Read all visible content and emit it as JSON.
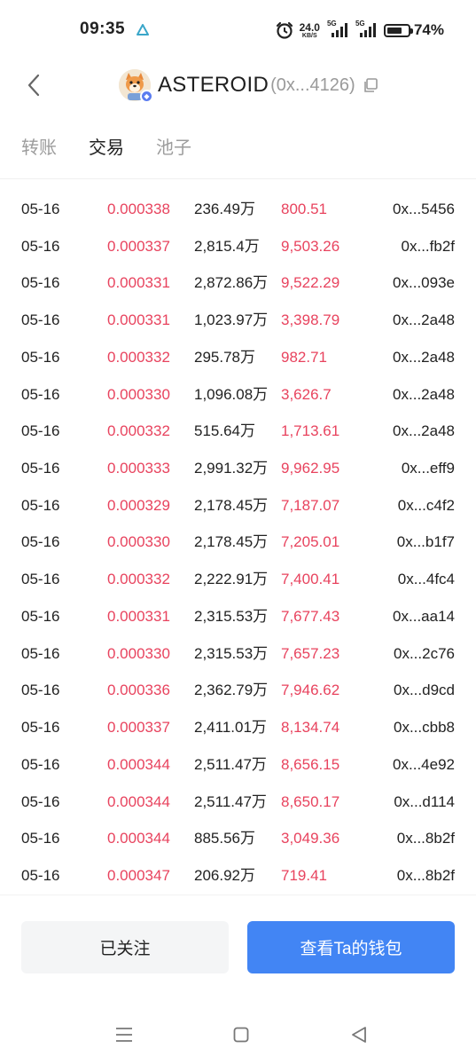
{
  "status_bar": {
    "time": "09:35",
    "net_speed": "24.0",
    "net_unit": "KB/S",
    "sim1_tag": "5G",
    "sim2_tag": "5G",
    "battery_pct": "74%",
    "battery_level": 0.74
  },
  "header": {
    "token_name": "ASTEROID",
    "token_address": "(0x...4126)"
  },
  "tabs": [
    {
      "label": "转账",
      "active": false
    },
    {
      "label": "交易",
      "active": true
    },
    {
      "label": "池子",
      "active": false
    }
  ],
  "trades": [
    {
      "date": "05-16",
      "price": "0.000338",
      "amount": "236.49万",
      "value": "800.51",
      "address": "0x...5456"
    },
    {
      "date": "05-16",
      "price": "0.000337",
      "amount": "2,815.4万",
      "value": "9,503.26",
      "address": "0x...fb2f"
    },
    {
      "date": "05-16",
      "price": "0.000331",
      "amount": "2,872.86万",
      "value": "9,522.29",
      "address": "0x...093e"
    },
    {
      "date": "05-16",
      "price": "0.000331",
      "amount": "1,023.97万",
      "value": "3,398.79",
      "address": "0x...2a48"
    },
    {
      "date": "05-16",
      "price": "0.000332",
      "amount": "295.78万",
      "value": "982.71",
      "address": "0x...2a48"
    },
    {
      "date": "05-16",
      "price": "0.000330",
      "amount": "1,096.08万",
      "value": "3,626.7",
      "address": "0x...2a48"
    },
    {
      "date": "05-16",
      "price": "0.000332",
      "amount": "515.64万",
      "value": "1,713.61",
      "address": "0x...2a48"
    },
    {
      "date": "05-16",
      "price": "0.000333",
      "amount": "2,991.32万",
      "value": "9,962.95",
      "address": "0x...eff9"
    },
    {
      "date": "05-16",
      "price": "0.000329",
      "amount": "2,178.45万",
      "value": "7,187.07",
      "address": "0x...c4f2"
    },
    {
      "date": "05-16",
      "price": "0.000330",
      "amount": "2,178.45万",
      "value": "7,205.01",
      "address": "0x...b1f7"
    },
    {
      "date": "05-16",
      "price": "0.000332",
      "amount": "2,222.91万",
      "value": "7,400.41",
      "address": "0x...4fc4"
    },
    {
      "date": "05-16",
      "price": "0.000331",
      "amount": "2,315.53万",
      "value": "7,677.43",
      "address": "0x...aa14"
    },
    {
      "date": "05-16",
      "price": "0.000330",
      "amount": "2,315.53万",
      "value": "7,657.23",
      "address": "0x...2c76"
    },
    {
      "date": "05-16",
      "price": "0.000336",
      "amount": "2,362.79万",
      "value": "7,946.62",
      "address": "0x...d9cd"
    },
    {
      "date": "05-16",
      "price": "0.000337",
      "amount": "2,411.01万",
      "value": "8,134.74",
      "address": "0x...cbb8"
    },
    {
      "date": "05-16",
      "price": "0.000344",
      "amount": "2,511.47万",
      "value": "8,656.15",
      "address": "0x...4e92"
    },
    {
      "date": "05-16",
      "price": "0.000344",
      "amount": "2,511.47万",
      "value": "8,650.17",
      "address": "0x...d114"
    },
    {
      "date": "05-16",
      "price": "0.000344",
      "amount": "885.56万",
      "value": "3,049.36",
      "address": "0x...8b2f"
    },
    {
      "date": "05-16",
      "price": "0.000347",
      "amount": "206.92万",
      "value": "719.41",
      "address": "0x...8b2f"
    }
  ],
  "actions": {
    "follow_label": "已关注",
    "wallet_label": "查看Ta的钱包"
  },
  "colors": {
    "sell_red": "#e8435e",
    "primary_blue": "#4285f4"
  },
  "icons": {
    "back": "back-arrow-icon",
    "copy": "copy-icon",
    "nav_menu": "menu-icon",
    "nav_home": "home-icon",
    "nav_back": "nav-back-icon"
  }
}
